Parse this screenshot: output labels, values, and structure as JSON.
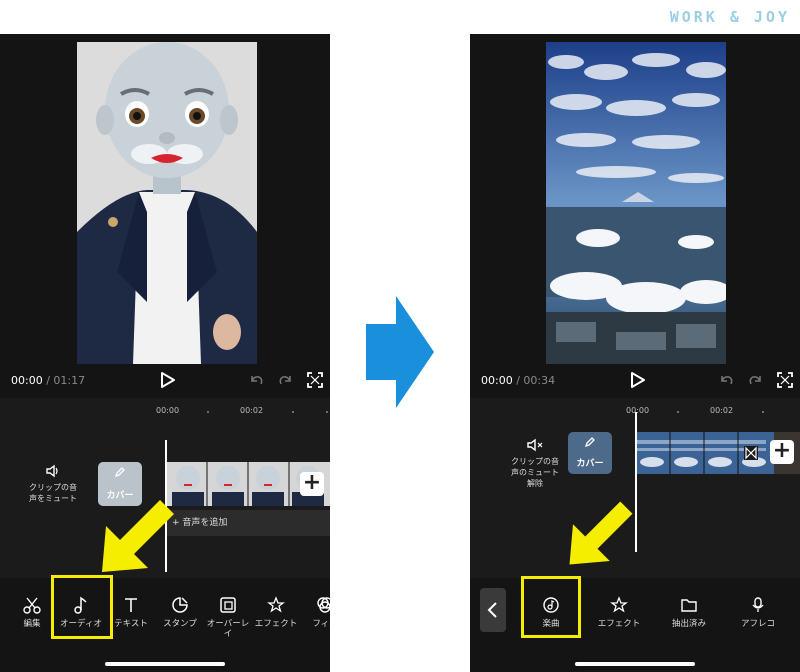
{
  "brand": "WORK & JOY",
  "left": {
    "time_current": "00:00",
    "time_sep": " / ",
    "time_total": "01:17",
    "ruler": [
      "00:00",
      "00:02"
    ],
    "mute_label_1": "クリップの音",
    "mute_label_2": "声をミュート",
    "cover_label": "カバー",
    "add_audio": "+ 音声を追加",
    "plus": "+",
    "tools": [
      {
        "label": "編集",
        "icon": "scissors-icon"
      },
      {
        "label": "オーディオ",
        "icon": "music-note-icon"
      },
      {
        "label": "テキスト",
        "icon": "text-icon"
      },
      {
        "label": "スタンプ",
        "icon": "sticker-icon"
      },
      {
        "label_1": "オーバーレ",
        "label_2": "イ",
        "icon": "overlay-icon"
      },
      {
        "label": "エフェクト",
        "icon": "effects-star-icon"
      },
      {
        "label": "フィル",
        "icon": "filter-icon"
      }
    ]
  },
  "right": {
    "time_current": "00:00",
    "time_sep": " / ",
    "time_total": "00:34",
    "ruler": [
      "00:00",
      "00:02"
    ],
    "mute_label_1": "クリップの音",
    "mute_label_2": "声のミュート",
    "mute_label_3": "解除",
    "cover_label": "カバー",
    "plus": "+",
    "tools": [
      {
        "label": "楽曲",
        "icon": "music-disc-icon"
      },
      {
        "label": "エフェクト",
        "icon": "effects-star-icon"
      },
      {
        "label": "抽出済み",
        "icon": "folder-icon"
      },
      {
        "label": "アフレコ",
        "icon": "microphone-icon"
      }
    ]
  },
  "colors": {
    "highlight": "#f5ee00",
    "arrow": "#1a8fdc",
    "brand": "#9ccfe3"
  }
}
